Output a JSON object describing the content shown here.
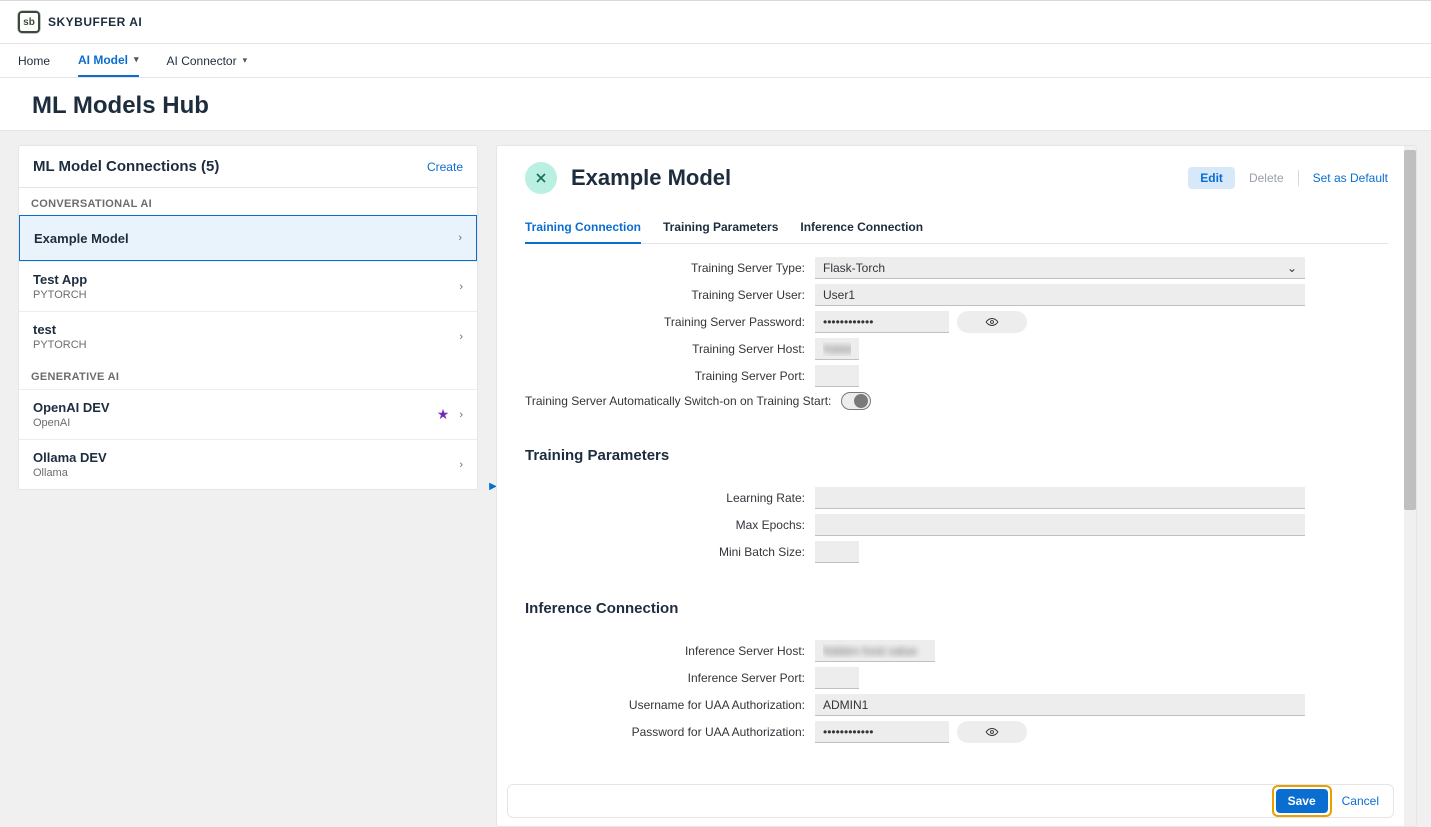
{
  "brand": "SKYBUFFER AI",
  "nav": {
    "home": "Home",
    "ai_model": "AI Model",
    "ai_connector": "AI Connector"
  },
  "page_title": "ML Models Hub",
  "sidebar": {
    "title": "ML Model Connections (5)",
    "create": "Create",
    "cat1": "CONVERSATIONAL AI",
    "cat2": "GENERATIVE AI",
    "items": [
      {
        "name": "Example Model",
        "sub": ""
      },
      {
        "name": "Test App",
        "sub": "PYTORCH"
      },
      {
        "name": "test",
        "sub": "PYTORCH"
      },
      {
        "name": "OpenAI DEV",
        "sub": "OpenAI"
      },
      {
        "name": "Ollama DEV",
        "sub": "Ollama"
      }
    ]
  },
  "detail": {
    "title": "Example Model",
    "actions": {
      "edit": "Edit",
      "delete": "Delete",
      "default": "Set as Default"
    },
    "tabs": {
      "t1": "Training Connection",
      "t2": "Training Parameters",
      "t3": "Inference Connection"
    },
    "tc": {
      "l_type": "Training Server Type:",
      "v_type": "Flask-Torch",
      "l_user": "Training Server User:",
      "v_user": "User1",
      "l_pass": "Training Server Password:",
      "v_pass": "••••••••••••",
      "l_host": "Training Server Host:",
      "v_host": "blurred",
      "l_port": "Training Server Port:",
      "v_port": "",
      "l_auto": "Training Server Automatically Switch-on on Training Start:"
    },
    "tp": {
      "title": "Training Parameters",
      "l_lr": "Learning Rate:",
      "l_ep": "Max Epochs:",
      "l_mb": "Mini Batch Size:"
    },
    "ic": {
      "title": "Inference Connection",
      "l_host": "Inference Server Host:",
      "v_host": "blurred-long",
      "l_port": "Inference Server Port:",
      "l_user": "Username for UAA Authorization:",
      "v_user": "ADMIN1",
      "l_pass": "Password for UAA Authorization:",
      "v_pass": "••••••••••••"
    },
    "footer": {
      "save": "Save",
      "cancel": "Cancel"
    }
  }
}
